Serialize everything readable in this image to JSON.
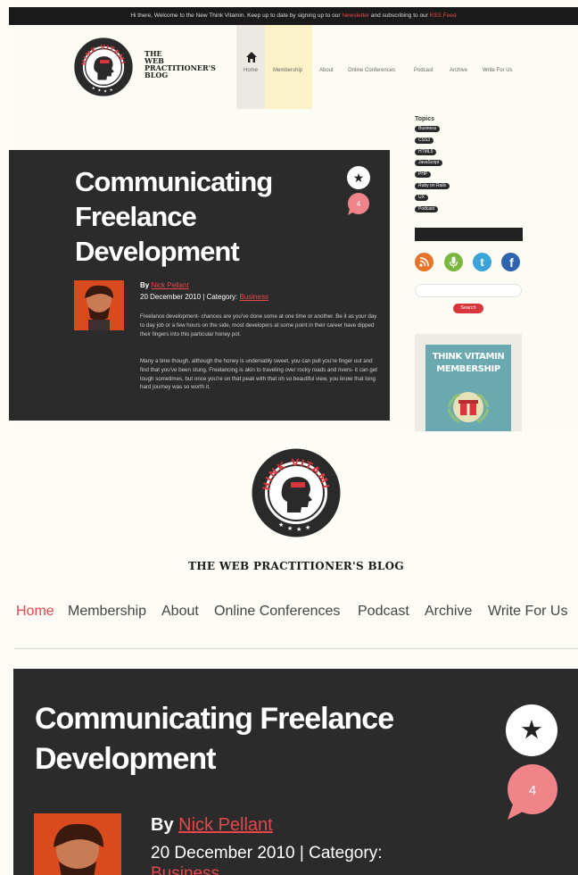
{
  "desktop": {
    "topbar": {
      "text_before": "Hi there, Welcome to the New Think Vitamin. Keep up to date by signing up to our ",
      "newsletter_link": "Newsletter",
      "text_middle": " and subscribing to our ",
      "rss_link": "RSS Feed",
      "text_after": ""
    },
    "logo_text": "THINK VITAMIN",
    "blog_title": [
      "THE",
      "WEB",
      "PRACTITIONER'S",
      "BLOG"
    ],
    "nav": [
      "Home",
      "Membership",
      "About",
      "Online Conferences",
      "Podcast",
      "Archive",
      "Write For Us"
    ],
    "post": {
      "title": [
        "Communicating",
        "Freelance",
        "Development"
      ],
      "comment_count": "4",
      "by": "By",
      "author": "Nick Pellant",
      "date_category": "20 December 2010 | Category: ",
      "category": "Business",
      "paragraphs": [
        "Freelance development- chances are you've done some at one time or another. Be it as your day to day job or a few hours on the side, most developers at some point in their career have dipped their fingers into this particular honey pot.",
        "Many a time though, although the honey is undeniably sweet, you can pull you're finger out and find that you've been stung. Freelancing is akin to traveling over rocky roads and rivers- it can get tough sometimes, but once you're on that peak with that oh so beautiful view, you know that long hard journey was so worth it."
      ]
    },
    "sidebar": {
      "topics_heading": "Topics",
      "topics": [
        "Business",
        "CSS3",
        "HTML5",
        "JavaScript",
        "PHP",
        "Ruby on Rails",
        "UX",
        "Podcast"
      ],
      "search_button": "Search",
      "membership_title": [
        "THINK VITAMIN",
        "MEMBERSHIP"
      ]
    },
    "social_icons": [
      "rss-icon",
      "podcast-mic-icon",
      "twitter-icon",
      "facebook-icon"
    ],
    "social_colors": [
      "#e8742c",
      "#79b73f",
      "#3aa3d8",
      "#2f65ae"
    ]
  },
  "mobile": {
    "logo_text": "THINK VITAMIN",
    "blog_title": "THE WEB PRACTITIONER'S BLOG",
    "nav": [
      "Home",
      "Membership",
      "About",
      "Online Conferences",
      "Podcast",
      "Archive",
      "Write For Us"
    ],
    "post": {
      "title": [
        "Communicating Freelance",
        "Development"
      ],
      "comment_count": "4",
      "by": "By",
      "author": "Nick Pellant",
      "date_category": "20 December 2010 | Category:",
      "category": "Business"
    }
  },
  "colors": {
    "accent": "#e8474a",
    "dark": "#2b2b2b",
    "bubble": "#f08589",
    "page_bg": "#fdfcf6"
  }
}
